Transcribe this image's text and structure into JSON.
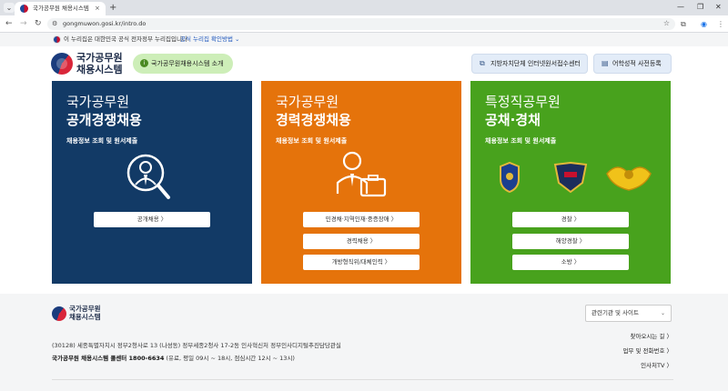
{
  "browser": {
    "tab_title": "국가공무원 채용시스템",
    "tab_close": "×",
    "new_tab": "+",
    "url": "gongmuwon.gosi.kr/intro.do"
  },
  "gov_banner": {
    "text": "이 누리집은 대한민국 공식 전자정부 누리집입니다.",
    "link": "공식 누리집 확인방법 ⌄"
  },
  "header": {
    "logo_line1": "국가공무원",
    "logo_line2": "채용시스템",
    "intro_button": "국가공무원채용시스템 소개",
    "center_button": "지방자치단체 인터넷원서접수센터",
    "language_button": "어학성적 사전등록"
  },
  "cards": [
    {
      "title1": "국가공무원",
      "title2": "공개경쟁채용",
      "subtitle": "채용정보 조회 및 원서제출",
      "buttons": [
        "공개채용 〉"
      ]
    },
    {
      "title1": "국가공무원",
      "title2": "경력경쟁채용",
      "subtitle": "채용정보 조회 및 원서제출",
      "buttons": [
        "민경채·지역인재·중증장애 〉",
        "경력채용 〉",
        "개방형직위/대체인력 〉"
      ]
    },
    {
      "title1": "특정직공무원",
      "title2": "공채·경채",
      "subtitle": "채용정보 조회 및 원서제출",
      "buttons": [
        "경찰 〉",
        "해양경찰 〉",
        "소방 〉"
      ]
    }
  ],
  "footer": {
    "logo_line1": "국가공무원",
    "logo_line2": "채용시스템",
    "related_select": "관련기관 및 사이트",
    "links": [
      "찾아오시는 길 〉",
      "업무 및 전화번호 〉",
      "인사처TV 〉"
    ],
    "address": "(30128) 세종특별자치시 정부2청사로 13 (나성동) 정부세종2청사 17-2동 인사혁신처 정부인사디지털추진담당관실",
    "call_center_label": "국가공무원 채용시스템 콜센터 1800-6634",
    "call_center_hours": " (유료, 평일 09시 ~ 18시, 점심시간 12시 ~ 13시)"
  },
  "colors": {
    "card_blue": "#123a66",
    "card_orange": "#e5730b",
    "card_green": "#48a21d",
    "intro_green": "#cdeeb8"
  }
}
